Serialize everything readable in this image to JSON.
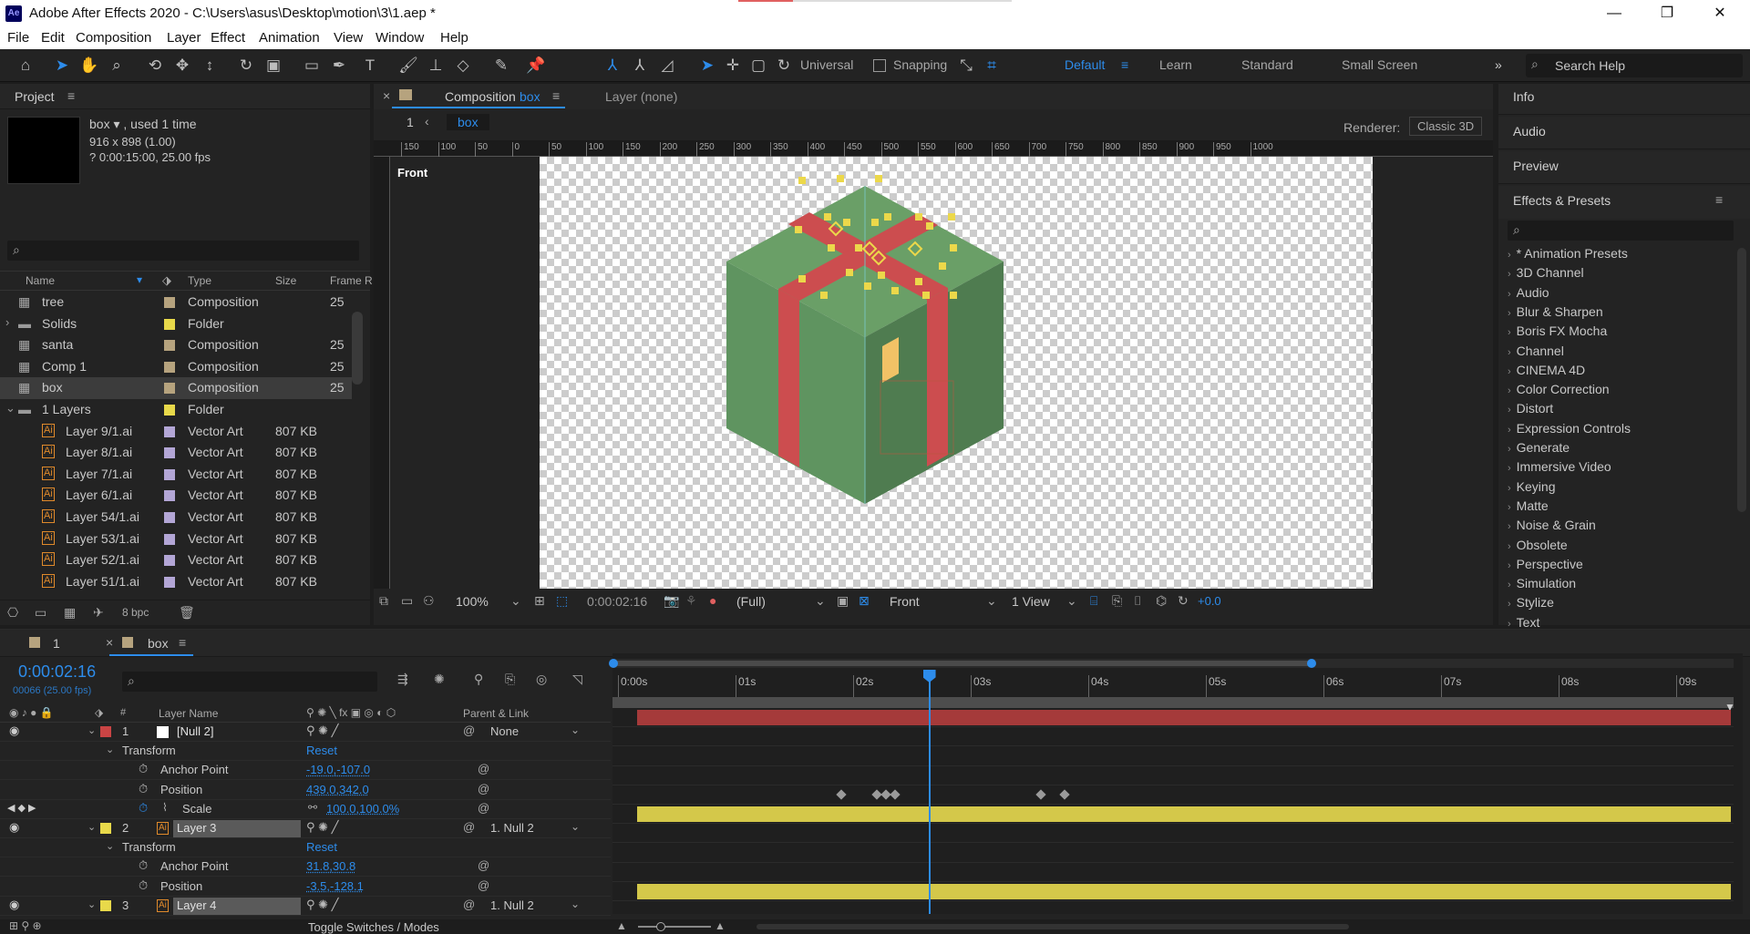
{
  "window": {
    "title": "Adobe After Effects 2020 - C:\\Users\\asus\\Desktop\\motion\\3\\1.aep *",
    "logo": "Ae",
    "minimize": "—",
    "maximize": "❐",
    "close": "✕"
  },
  "menu": [
    "File",
    "Edit",
    "Composition",
    "Layer",
    "Effect",
    "Animation",
    "View",
    "Window",
    "Help"
  ],
  "toolbar": {
    "axis_mode": "Universal",
    "snapping_label": "Snapping",
    "workspaces": [
      "Default",
      "Learn",
      "Standard",
      "Small Screen"
    ],
    "active_workspace": "Default",
    "search_placeholder": "Search Help",
    "more": "»"
  },
  "project": {
    "tab": "Project",
    "selected_name": "box ▾ , used 1 time",
    "dimensions": "916 x 898 (1.00)",
    "duration": "? 0:00:15:00, 25.00 fps",
    "search_placeholder": "",
    "columns": [
      "Name",
      "Type",
      "Size",
      "Frame R"
    ],
    "items": [
      {
        "name": "tree",
        "type": "Composition",
        "size": "25",
        "color": "#b6a37e",
        "kind": "comp",
        "indent": 0
      },
      {
        "name": "Solids",
        "type": "Folder",
        "size": "",
        "color": "#e8d94a",
        "kind": "folder",
        "indent": 0,
        "expand": "›"
      },
      {
        "name": "santa",
        "type": "Composition",
        "size": "25",
        "color": "#b6a37e",
        "kind": "comp",
        "indent": 0
      },
      {
        "name": "Comp 1",
        "type": "Composition",
        "size": "25",
        "color": "#b6a37e",
        "kind": "comp",
        "indent": 0
      },
      {
        "name": "box",
        "type": "Composition",
        "size": "25",
        "color": "#b6a37e",
        "kind": "comp",
        "indent": 0,
        "selected": true
      },
      {
        "name": "1 Layers",
        "type": "Folder",
        "size": "",
        "color": "#e8d94a",
        "kind": "folder",
        "indent": 0,
        "expand": "⌄"
      },
      {
        "name": "Layer 9/1.ai",
        "type": "Vector Art",
        "size": "807 KB",
        "color": "#b3a6d6",
        "kind": "ai",
        "indent": 1
      },
      {
        "name": "Layer 8/1.ai",
        "type": "Vector Art",
        "size": "807 KB",
        "color": "#b3a6d6",
        "kind": "ai",
        "indent": 1
      },
      {
        "name": "Layer 7/1.ai",
        "type": "Vector Art",
        "size": "807 KB",
        "color": "#b3a6d6",
        "kind": "ai",
        "indent": 1
      },
      {
        "name": "Layer 6/1.ai",
        "type": "Vector Art",
        "size": "807 KB",
        "color": "#b3a6d6",
        "kind": "ai",
        "indent": 1
      },
      {
        "name": "Layer 54/1.ai",
        "type": "Vector Art",
        "size": "807 KB",
        "color": "#b3a6d6",
        "kind": "ai",
        "indent": 1
      },
      {
        "name": "Layer 53/1.ai",
        "type": "Vector Art",
        "size": "807 KB",
        "color": "#b3a6d6",
        "kind": "ai",
        "indent": 1
      },
      {
        "name": "Layer 52/1.ai",
        "type": "Vector Art",
        "size": "807 KB",
        "color": "#b3a6d6",
        "kind": "ai",
        "indent": 1
      },
      {
        "name": "Layer 51/1.ai",
        "type": "Vector Art",
        "size": "807 KB",
        "color": "#b3a6d6",
        "kind": "ai",
        "indent": 1
      }
    ],
    "bpc": "8 bpc"
  },
  "composition": {
    "close": "×",
    "tab_prefix": "Composition",
    "tab_name": "box",
    "layer_tab": "Layer  (none)",
    "breadcrumb_index": "1",
    "breadcrumb": "box",
    "renderer_label": "Renderer:",
    "renderer_value": "Classic 3D",
    "view_label": "Front",
    "ruler_ticks": [
      "150",
      "100",
      "50",
      "0",
      "50",
      "100",
      "150",
      "200",
      "250",
      "300",
      "350",
      "400",
      "450",
      "500",
      "550",
      "600",
      "650",
      "700",
      "750",
      "800",
      "850",
      "900",
      "950",
      "1000"
    ],
    "zoom": "100%",
    "timecode": "0:00:02:16",
    "resolution": "(Full)",
    "camera": "Front",
    "views": "1 View",
    "exposure": "+0.0"
  },
  "right_panels": {
    "info": "Info",
    "audio": "Audio",
    "preview": "Preview",
    "effects_title": "Effects & Presets",
    "effects": [
      "* Animation Presets",
      "3D Channel",
      "Audio",
      "Blur & Sharpen",
      "Boris FX Mocha",
      "Channel",
      "CINEMA 4D",
      "Color Correction",
      "Distort",
      "Expression Controls",
      "Generate",
      "Immersive Video",
      "Keying",
      "Matte",
      "Noise & Grain",
      "Obsolete",
      "Perspective",
      "Simulation",
      "Stylize",
      "Text"
    ]
  },
  "timeline": {
    "tab1_index": "1",
    "tab2_name": "box",
    "timecode": "0:00:02:16",
    "frame_info": "00066 (25.00 fps)",
    "col_layer_name": "Layer Name",
    "col_parent": "Parent & Link",
    "time_ticks": [
      "0:00s",
      "01s",
      "02s",
      "03s",
      "04s",
      "05s",
      "06s",
      "07s",
      "08s",
      "09s"
    ],
    "playhead_seconds": 2.64,
    "layers": [
      {
        "num": "1",
        "name": "[Null 2]",
        "color": "#c94444",
        "parent": "None",
        "bar_color": "#a53a3a"
      },
      {
        "num": "2",
        "name": "Layer 3",
        "color": "#e8d94a",
        "parent": "1. Null 2",
        "bar_color": "#d4c84a"
      },
      {
        "num": "3",
        "name": "Layer 4",
        "color": "#e8d94a",
        "parent": "1. Null 2",
        "bar_color": "#d4c84a"
      }
    ],
    "transform_label": "Transform",
    "reset_label": "Reset",
    "null_props": [
      {
        "name": "Anchor Point",
        "value": "-19.0,-107.0"
      },
      {
        "name": "Position",
        "value": "439.0,342.0"
      },
      {
        "name": "Scale",
        "value": "100.0,100.0%"
      }
    ],
    "layer3_props": [
      {
        "name": "Anchor Point",
        "value": "31.8,30.8"
      },
      {
        "name": "Position",
        "value": "-3.5,-128.1"
      }
    ],
    "scale_keyframes_seconds": [
      1.9,
      2.2,
      2.28,
      2.36,
      3.6,
      3.8
    ],
    "footer": "Toggle Switches / Modes"
  }
}
